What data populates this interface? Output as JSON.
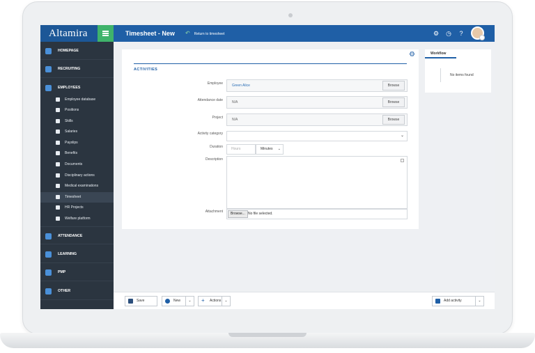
{
  "app": {
    "brand": "Altamira",
    "page_title": "Timesheet - New",
    "return_link": "Return to timesheet"
  },
  "colors": {
    "primary": "#1f5fa6",
    "accent_green": "#3fb36b",
    "sidebar_bg": "#2b3540"
  },
  "header_icons": [
    "gear-icon",
    "clock-icon",
    "help-icon",
    "user-avatar"
  ],
  "sidebar": {
    "homepage": "HOMEPAGE",
    "recruiting": "RECRUITING",
    "employees": "EMPLOYEES",
    "employee_items": [
      "Employee database",
      "Positions",
      "Skills",
      "Salaries",
      "Payslips",
      "Benefits",
      "Documents",
      "Disciplinary actions",
      "Medical examinations",
      "Timesheet",
      "HR Projects",
      "Welfare platform"
    ],
    "active_item": "Timesheet",
    "attendance": "ATTENDANCE",
    "learning": "LEARNING",
    "pmp": "PMP",
    "other": "OTHER"
  },
  "form": {
    "section_title": "ACTIVITIES",
    "employee_label": "Employee",
    "employee_value": "Green Alice",
    "attendance_date_label": "Attendance date",
    "attendance_date_value": "N/A",
    "project_label": "Project",
    "project_value": "N/A",
    "browse_label": "Browse",
    "activity_category_label": "Activity category",
    "activity_category_value": "",
    "duration_label": "Duration",
    "duration_placeholder": "Hours",
    "duration_unit": "Minutes",
    "description_label": "Description",
    "attachment_label": "Attachment",
    "file_button": "Browse...",
    "file_status": "No file selected."
  },
  "workflow": {
    "tab": "Workflow",
    "empty": "No items found"
  },
  "toolbar": {
    "save": "Save",
    "new": "New",
    "actions": "Actions",
    "add_activity": "Add activity"
  }
}
